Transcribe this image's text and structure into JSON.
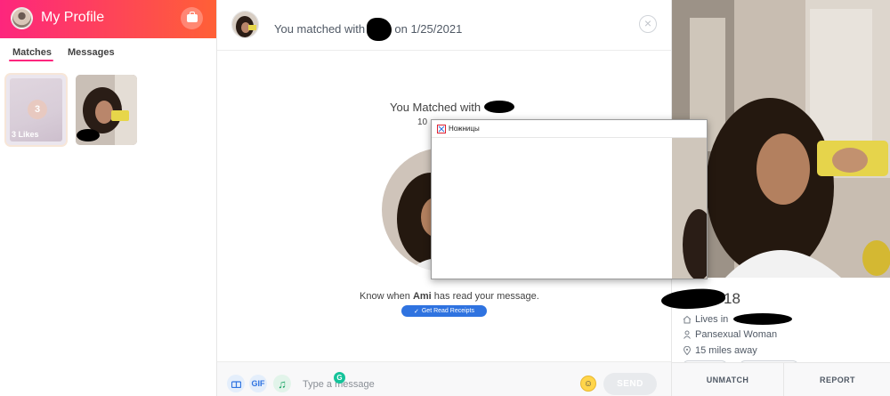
{
  "sidebar": {
    "title": "My Profile",
    "tabs": [
      {
        "label": "Matches",
        "active": true
      },
      {
        "label": "Messages",
        "active": false
      }
    ],
    "likes_card": {
      "count": "3",
      "label": "3 Likes"
    },
    "accent_gradient": [
      "#fd267d",
      "#ff6036"
    ]
  },
  "chat": {
    "header": {
      "prefix": "You matched with",
      "suffix": "on 1/25/2021"
    },
    "intro": {
      "title": "You Matched with",
      "subtitle": "10"
    },
    "read_receipts": {
      "text_before": "Know when ",
      "name": "Ami",
      "text_after": " has read your message.",
      "button": "Get Read Receipts"
    },
    "footer": {
      "gif_label": "GIF",
      "input_placeholder": "Type a message",
      "send_label": "SEND"
    }
  },
  "snipping_tool": {
    "title": "Ножницы"
  },
  "profile": {
    "age_partial": "18",
    "lives_prefix": "Lives in",
    "orientation": "Pansexual Woman",
    "distance": "15 miles away",
    "actions": {
      "unmatch": "UNMATCH",
      "report": "REPORT"
    }
  },
  "icons": {
    "briefcase": "briefcase-icon",
    "close": "close-icon",
    "gift": "gift-icon",
    "gif": "gif-icon",
    "music": "music-icon",
    "emoji": "emoji-icon",
    "grammarly": "grammarly-icon",
    "home": "home-icon",
    "person": "person-icon",
    "location": "location-pin-icon",
    "check": "check-icon",
    "scissors": "scissors-icon"
  }
}
